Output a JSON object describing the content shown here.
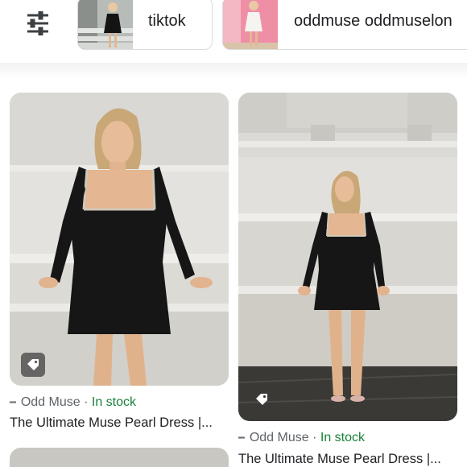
{
  "chips": {
    "filter_icon": "tune-sliders-icon",
    "items": [
      {
        "label": "tiktok"
      },
      {
        "label": "oddmuse oddmuselon"
      }
    ]
  },
  "results": [
    {
      "source": "Odd Muse",
      "separator": "·",
      "availability": "In stock",
      "title": "The Ultimate Muse Pearl Dress |...",
      "badge_icon": "price-tag-icon"
    },
    {
      "source": "Odd Muse",
      "separator": "·",
      "availability": "In stock",
      "title": "The Ultimate Muse Pearl Dress |...",
      "badge_icon": "price-tag-icon"
    }
  ],
  "colors": {
    "in_stock": "#188038",
    "source_text": "#5f6368",
    "chip_border": "#dadce0"
  }
}
